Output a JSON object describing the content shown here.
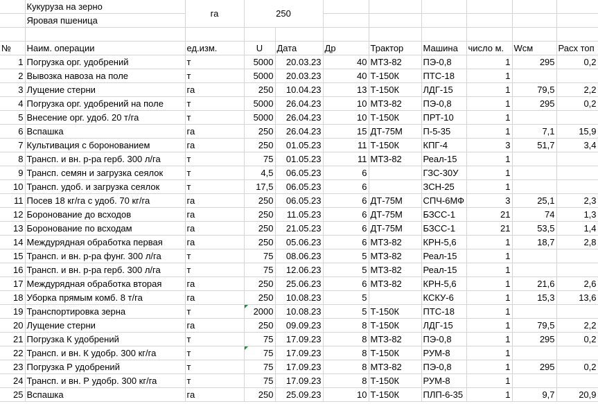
{
  "header": {
    "crop": "Кукуруза на зерно",
    "predecessor": "Яровая пшеница",
    "unit": "га",
    "area": "250"
  },
  "columns": [
    "№",
    "Наим. операции",
    "ед.изм.",
    "U",
    "Дата",
    "Др",
    "Трактор",
    "Машина",
    "число м.",
    "Wсм",
    "Расх топ"
  ],
  "rows": [
    [
      "1",
      "Погрузка орг. удобрений",
      "т",
      "5000",
      "20.03.23",
      "40",
      "МТЗ-82",
      "ПЭ-0,8",
      "1",
      "295",
      "0,2"
    ],
    [
      "2",
      "Вывозка навоза на поле",
      "т",
      "5000",
      "20.03.23",
      "40",
      "Т-150К",
      "ПТС-18",
      "1",
      "",
      ""
    ],
    [
      "3",
      "Лущение стерни",
      "га",
      "250",
      "10.04.23",
      "13",
      "Т-150К",
      "ЛДГ-15",
      "1",
      "79,5",
      "2,2"
    ],
    [
      "4",
      "Погрузка орг. удобрений на поле",
      "т",
      "5000",
      "26.04.23",
      "10",
      "МТЗ-82",
      "ПЭ-0,8",
      "1",
      "295",
      "0,2"
    ],
    [
      "5",
      "Внесение орг. удоб. 20 т/га",
      "т",
      "5000",
      "26.04.23",
      "10",
      "Т-150К",
      "ПРТ-10",
      "1",
      "",
      ""
    ],
    [
      "6",
      "Вспашка",
      "га",
      "250",
      "26.04.23",
      "15",
      "ДТ-75М",
      "П-5-35",
      "1",
      "7,1",
      "15,9"
    ],
    [
      "7",
      "Культивация с боронованием",
      "га",
      "250",
      "01.05.23",
      "11",
      "Т-150К",
      "КПГ-4",
      "3",
      "51,7",
      "3,4"
    ],
    [
      "8",
      "Трансп. и вн. р-ра герб. 300 л/га",
      "т",
      "75",
      "01.05.23",
      "11",
      "МТЗ-82",
      "Реал-15",
      "1",
      "",
      ""
    ],
    [
      "9",
      "Трансп. семян и загрузка сеялок",
      "т",
      "4,5",
      "06.05.23",
      "6",
      "",
      "ГЗС-30У",
      "1",
      "",
      ""
    ],
    [
      "10",
      "Трансп. удоб. и загрузка сеялок",
      "т",
      "17,5",
      "06.05.23",
      "6",
      "",
      "ЗСН-25",
      "1",
      "",
      ""
    ],
    [
      "11",
      "Посев 18 кг/га с удоб. 70 кг/га",
      "га",
      "250",
      "06.05.23",
      "6",
      "ДТ-75М",
      "СПЧ-6МФ",
      "3",
      "25,1",
      "2,3"
    ],
    [
      "12",
      "Боронование до всходов",
      "га",
      "250",
      "11.05.23",
      "6",
      "ДТ-75М",
      "БЗСС-1",
      "21",
      "74",
      "1,3"
    ],
    [
      "13",
      "Боронование по всходам",
      "га",
      "250",
      "21.05.23",
      "6",
      "ДТ-75М",
      "БЗСС-1",
      "21",
      "53,5",
      "1,4"
    ],
    [
      "14",
      "Междурядная обработка первая",
      "га",
      "250",
      "05.06.23",
      "6",
      "МТЗ-82",
      "КРН-5,6",
      "1",
      "18,7",
      "2,8"
    ],
    [
      "15",
      "Трансп. и вн. р-ра фунг. 300 л/га",
      "т",
      "75",
      "08.06.23",
      "5",
      "МТЗ-82",
      "Реал-15",
      "1",
      "",
      ""
    ],
    [
      "16",
      "Трансп. и вн. р-ра герб. 300 л/га",
      "т",
      "75",
      "12.06.23",
      "5",
      "МТЗ-82",
      "Реал-15",
      "1",
      "",
      ""
    ],
    [
      "17",
      "Междурядная обработка вторая",
      "га",
      "250",
      "25.06.23",
      "6",
      "МТЗ-82",
      "КРН-5,6",
      "1",
      "21,6",
      "2,6"
    ],
    [
      "18",
      "Уборка прямым комб. 8 т/га",
      "га",
      "250",
      "10.08.23",
      "5",
      "",
      "КСКУ-6",
      "1",
      "15,3",
      "13,6"
    ],
    [
      "19",
      "Транспортировка зерна",
      "т",
      "2000",
      "10.08.23",
      "5",
      "Т-150К",
      "ПТС-18",
      "1",
      "",
      ""
    ],
    [
      "20",
      "Лущение стерни",
      "га",
      "250",
      "09.09.23",
      "8",
      "Т-150К",
      "ЛДГ-15",
      "1",
      "79,5",
      "2,2"
    ],
    [
      "21",
      "Погрузка К удобрений",
      "т",
      "75",
      "17.09.23",
      "8",
      "МТЗ-82",
      "ПЭ-0,8",
      "1",
      "295",
      "0,2"
    ],
    [
      "22",
      "Трансп. и вн. К удобр. 300 кг/га",
      "т",
      "75",
      "17.09.23",
      "8",
      "Т-150К",
      "РУМ-8",
      "1",
      "",
      ""
    ],
    [
      "23",
      "Погрузка Р удобрений",
      "т",
      "75",
      "17.09.23",
      "8",
      "МТЗ-82",
      "ПЭ-0,8",
      "1",
      "295",
      "0,2"
    ],
    [
      "24",
      "Трансп. и вн. Р удобр. 300 кг/га",
      "т",
      "75",
      "17.09.23",
      "8",
      "Т-150К",
      "РУМ-8",
      "1",
      "",
      ""
    ],
    [
      "25",
      "Вспашка",
      "га",
      "250",
      "25.09.23",
      "10",
      "Т-150К",
      "ПЛП-6-35",
      "1",
      "9,7",
      "20,9"
    ]
  ],
  "accent": {
    "note_marker": "#1e8a3c",
    "grid": "#d4d4d4"
  }
}
